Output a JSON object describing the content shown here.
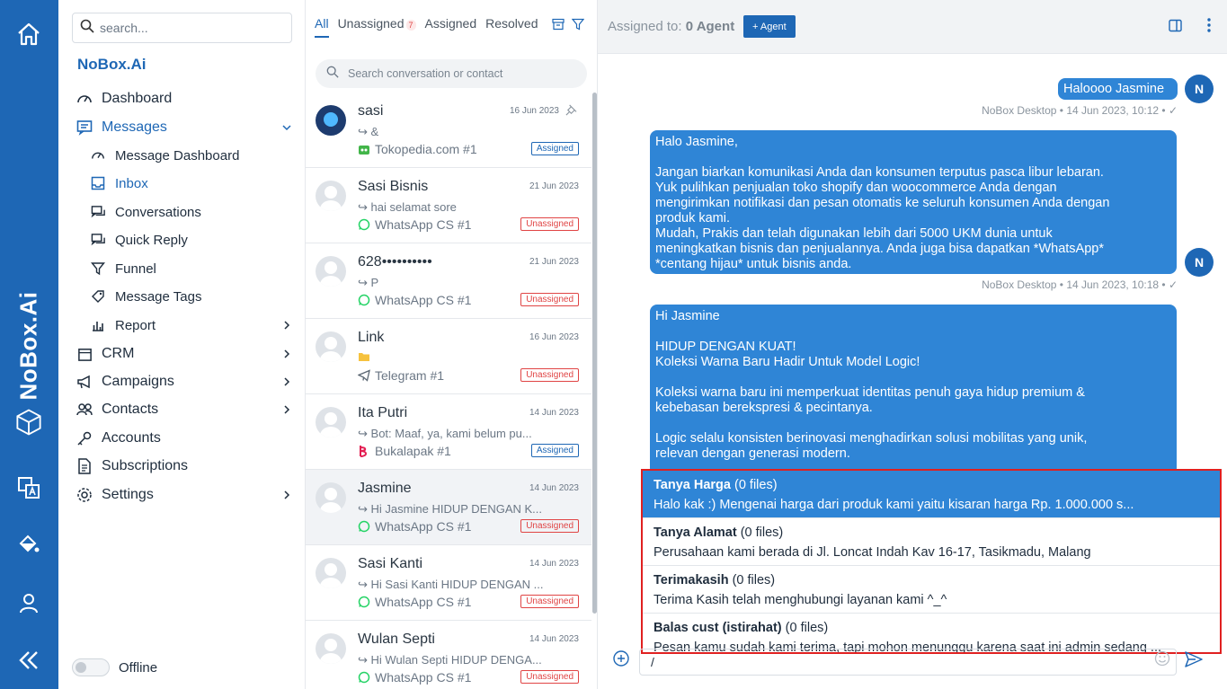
{
  "rail": {
    "brand": "NoBox.Ai",
    "icons": [
      "home-icon",
      "hexagon-icon",
      "translate-icon",
      "paint-bucket-icon",
      "user-icon",
      "collapse-icon"
    ],
    "color": "#1e67b5"
  },
  "sidebar": {
    "search_placeholder": "search...",
    "title": "NoBox.Ai",
    "items": [
      {
        "label": "Dashboard"
      },
      {
        "label": "Messages"
      },
      {
        "label": "Message Dashboard"
      },
      {
        "label": "Inbox"
      },
      {
        "label": "Conversations"
      },
      {
        "label": "Quick Reply"
      },
      {
        "label": "Funnel"
      },
      {
        "label": "Message Tags"
      },
      {
        "label": "Report"
      },
      {
        "label": "CRM"
      },
      {
        "label": "Campaigns"
      },
      {
        "label": "Contacts"
      },
      {
        "label": "Accounts"
      },
      {
        "label": "Subscriptions"
      },
      {
        "label": "Settings"
      }
    ],
    "offline_label": "Offline"
  },
  "conversations": {
    "tabs": [
      {
        "label": "All"
      },
      {
        "label": "Unassigned",
        "badge": "7"
      },
      {
        "label": "Assigned"
      },
      {
        "label": "Resolved"
      }
    ],
    "search_placeholder": "Search conversation or contact",
    "items": [
      {
        "name": "sasi",
        "date": "16 Jun 2023",
        "preview": "&",
        "channel": "Tokopedia.com #1",
        "status": "Assigned"
      },
      {
        "name": "Sasi Bisnis",
        "date": "21 Jun 2023",
        "preview": "hai selamat sore",
        "channel": "WhatsApp CS #1",
        "status": "Unassigned"
      },
      {
        "name": "628••••••••••",
        "date": "21 Jun 2023",
        "preview": "P",
        "channel": "WhatsApp CS #1",
        "status": "Unassigned"
      },
      {
        "name": "Link",
        "date": "16 Jun 2023",
        "preview": "",
        "channel": "Telegram #1",
        "status": "Unassigned"
      },
      {
        "name": "Ita Putri",
        "date": "14 Jun 2023",
        "preview": "Bot: Maaf, ya, kami belum pu...",
        "channel": "Bukalapak #1",
        "status": "Assigned"
      },
      {
        "name": "Jasmine",
        "date": "14 Jun 2023",
        "preview": "Hi Jasmine HIDUP DENGAN K...",
        "channel": "WhatsApp CS #1",
        "status": "Unassigned"
      },
      {
        "name": "Sasi Kanti",
        "date": "14 Jun 2023",
        "preview": "Hi Sasi Kanti HIDUP DENGAN ...",
        "channel": "WhatsApp CS #1",
        "status": "Unassigned"
      },
      {
        "name": "Wulan Septi",
        "date": "14 Jun 2023",
        "preview": "Hi Wulan Septi HIDUP DENGA...",
        "channel": "WhatsApp CS #1",
        "status": "Unassigned"
      }
    ]
  },
  "chat": {
    "assigned_label": "Assigned to:",
    "assigned_value": "0 Agent",
    "agent_button": "+ Agent",
    "avatar_initial": "N",
    "messages": [
      {
        "text": "Haloooo Jasmine",
        "meta": "NoBox Desktop • 14 Jun 2023, 10:12 • ✓"
      },
      {
        "text": "Halo Jasmine,\n\nJangan biarkan komunikasi Anda dan konsumen terputus pasca libur lebaran.\nYuk pulihkan penjualan toko shopify dan woocommerce Anda dengan\nmengirimkan notifikasi dan pesan otomatis ke seluruh konsumen Anda dengan\nproduk kami.\nMudah, Prakis dan telah digunakan lebih dari 5000 UKM dunia untuk\nmeningkatkan bisnis dan penjualannya. Anda juga bisa dapatkan *WhatsApp*\n*centang hijau* untuk bisnis anda.",
        "meta": "NoBox Desktop • 14 Jun 2023, 10:18 • ✓"
      },
      {
        "text": "Hi Jasmine\n\nHIDUP DENGAN KUAT!\nKoleksi Warna Baru Hadir Untuk Model Logic!\n\nKoleksi warna baru ini memperkuat identitas penuh gaya hidup premium &\nkebebasan berekspresi & pecintanya.\n\nLogic selalu konsisten berinovasi menghadirkan solusi mobilitas yang unik,\nrelevan dengan generasi modern."
      }
    ],
    "quick_replies": [
      {
        "title": "Tanya Harga",
        "files": "(0 files)",
        "body": "Halo kak :) Mengenai harga dari produk kami yaitu kisaran harga Rp. 1.000.000 s..."
      },
      {
        "title": "Tanya Alamat",
        "files": "(0 files)",
        "body": "Perusahaan kami berada di Jl. Loncat Indah Kav 16-17, Tasikmadu, Malang"
      },
      {
        "title": "Terimakasih",
        "files": "(0 files)",
        "body": "Terima Kasih telah menghubungi layanan kami ^_^"
      },
      {
        "title": "Balas cust (istirahat)",
        "files": "(0 files)",
        "body": "Pesan kamu sudah kami terima, tapi mohon menunggu karena saat ini admin sedang ..."
      }
    ],
    "compose_value": "/"
  }
}
